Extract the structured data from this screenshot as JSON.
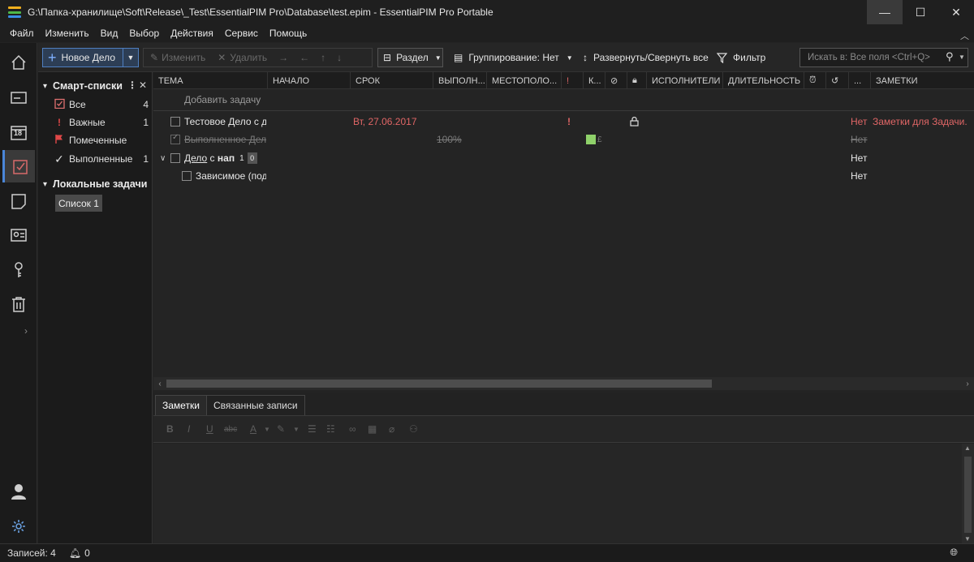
{
  "window": {
    "title": "G:\\Папка-хранилище\\Soft\\Release\\_Test\\EssentialPIM Pro\\Database\\test.epim - EssentialPIM Pro Portable",
    "controls": {
      "minimize": "—",
      "maximize": "☐",
      "close": "✕"
    }
  },
  "menu": [
    "Файл",
    "Изменить",
    "Вид",
    "Выбор",
    "Действия",
    "Сервис",
    "Помощь"
  ],
  "toolbar": {
    "new_task": "Новое Дело",
    "edit": "Изменить",
    "delete": "Удалить",
    "section": "Раздел",
    "grouping": "Группирование: Нет",
    "expand_collapse": "Развернуть/Свернуть все",
    "filter": "Фильтр",
    "search_placeholder": "Искать в: Все поля  <Ctrl+Q>"
  },
  "rail_icons": [
    "home-icon",
    "mail-icon",
    "calendar-icon",
    "tasks-icon",
    "notes-icon",
    "contacts-icon",
    "passwords-icon",
    "trash-icon",
    "user-icon",
    "settings-icon"
  ],
  "calendar_day": "18",
  "smart_lists": {
    "title": "Смарт-списки",
    "items": [
      {
        "label": "Все",
        "count": "4",
        "icon": "tasks-check-icon"
      },
      {
        "label": "Важные",
        "count": "1",
        "icon": "exclamation-icon"
      },
      {
        "label": "Помеченные",
        "count": "",
        "icon": "flag-icon"
      },
      {
        "label": "Выполненные",
        "count": "1",
        "icon": "checkmark-icon"
      }
    ]
  },
  "local_tasks": {
    "title": "Локальные задачи",
    "lists": [
      "Список 1"
    ]
  },
  "grid": {
    "columns": [
      "ТЕМА",
      "НАЧАЛО",
      "СРОК",
      "ВЫПОЛН...",
      "МЕСТОПОЛО...",
      "!",
      "К...",
      "ИСПОЛНИТЕЛИ",
      "ДЛИТЕЛЬНОСТЬ",
      "...",
      "ЗАМЕТКИ"
    ],
    "add_task": "Добавить задачу",
    "rows": [
      {
        "subject": "Тестовое Дело с д",
        "due": "Вт, 27.06.2017",
        "priority": "!",
        "reminder": "Нет",
        "notes": "Заметки для Задачи."
      },
      {
        "subject": "Выполненное Дело",
        "completion": "100%",
        "category_extra": "£",
        "reminder": "Нет"
      },
      {
        "subject_a": "Дело",
        "subject_b": " с ",
        "subject_c": "нап",
        "n1": "1",
        "n2": "0",
        "reminder": "Нет"
      },
      {
        "subject": "Зависимое (под",
        "reminder": "Нет"
      }
    ]
  },
  "colors": {
    "accent": "#4a86d8",
    "category_green": "#8fd16a",
    "red": "#e06666"
  },
  "notes_panel": {
    "tabs": [
      "Заметки",
      "Связанные записи"
    ],
    "format": {
      "bold": "B",
      "italic": "I",
      "underline": "U",
      "strike": "abc",
      "font_color": "A"
    }
  },
  "status": {
    "records": "Записей: 4",
    "reminders": "0"
  }
}
